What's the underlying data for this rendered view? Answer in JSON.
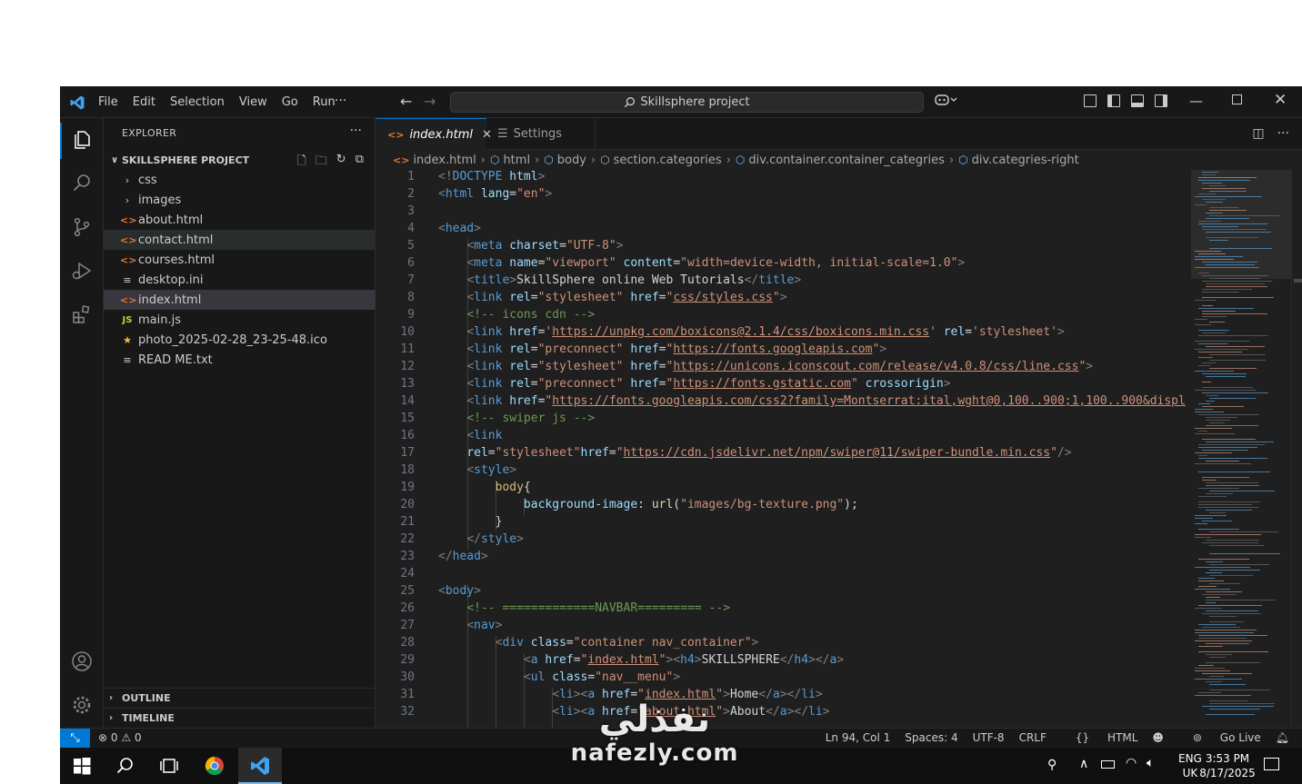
{
  "titlebar": {
    "menu": [
      "File",
      "Edit",
      "Selection",
      "View",
      "Go",
      "Run"
    ],
    "more": "···",
    "search": "Skillsphere project"
  },
  "explorer": {
    "header": "EXPLORER",
    "more": "···",
    "project": "SKILLSPHERE PROJECT",
    "items": [
      {
        "type": "folder",
        "label": "css"
      },
      {
        "type": "folder",
        "label": "images"
      },
      {
        "type": "html",
        "label": "about.html"
      },
      {
        "type": "html",
        "label": "contact.html"
      },
      {
        "type": "html",
        "label": "courses.html"
      },
      {
        "type": "ini",
        "label": "desktop.ini"
      },
      {
        "type": "html",
        "label": "index.html"
      },
      {
        "type": "js",
        "label": "main.js"
      },
      {
        "type": "star",
        "label": "photo_2025-02-28_23-25-48.ico"
      },
      {
        "type": "ini",
        "label": "READ ME.txt"
      }
    ],
    "outline": "OUTLINE",
    "timeline": "TIMELINE"
  },
  "tabs": [
    {
      "label": "index.html",
      "active": true
    },
    {
      "label": "Settings",
      "active": false
    }
  ],
  "breadcrumb": [
    "index.html",
    "html",
    "body",
    "section.categories",
    "div.container.container_categries",
    "div.categries-right"
  ],
  "code": {
    "line_numbers": [
      "1",
      "2",
      "3",
      "4",
      "5",
      "6",
      "7",
      "8",
      "9",
      "10",
      "11",
      "12",
      "13",
      "14",
      "15",
      "16",
      "17",
      "18",
      "19",
      "20",
      "21",
      "22",
      "23",
      "24",
      "25",
      "26",
      "27",
      "28",
      "29",
      "30",
      "31",
      "32"
    ]
  },
  "statusbar": {
    "errors": "0",
    "warnings": "0",
    "position": "Ln 94, Col 1",
    "spaces": "Spaces: 4",
    "encoding": "UTF-8",
    "eol": "CRLF",
    "language": "HTML",
    "golive": "Go Live"
  },
  "taskbar": {
    "lang": "ENG",
    "region": "UK",
    "time": "3:53 PM",
    "date": "8/17/2025"
  },
  "watermark": {
    "arabic": "نفذلي",
    "latin": "nafezly.com"
  },
  "colors": {
    "accent": "#0078d4",
    "editor_bg": "#1f1f1f",
    "sidebar_bg": "#181818",
    "html_icon": "#e37933",
    "tag": "#569cd6",
    "attr": "#9cdcfe",
    "string": "#ce9178",
    "comment": "#6a9955"
  }
}
